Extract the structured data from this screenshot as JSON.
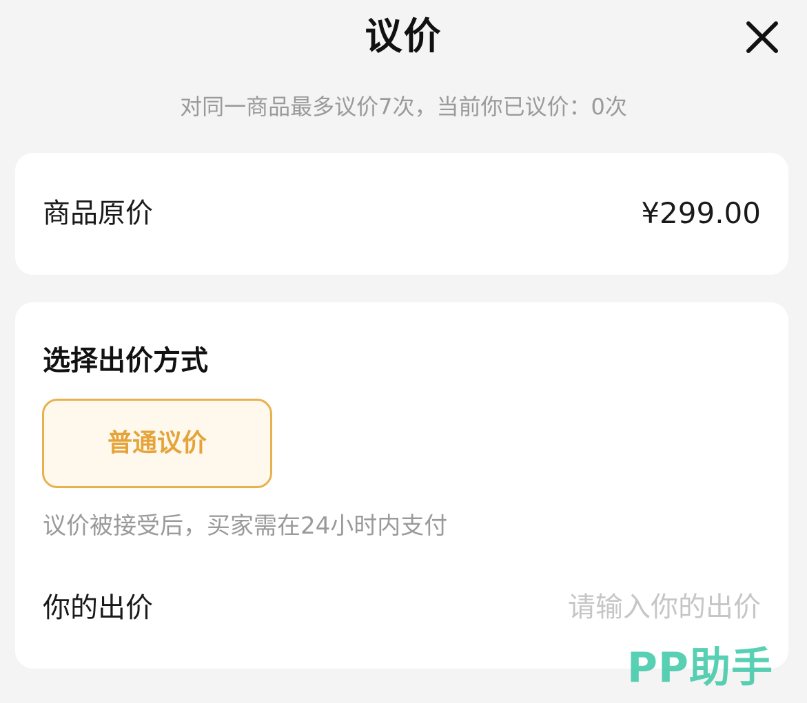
{
  "header": {
    "title": "议价",
    "close_icon": "close-icon"
  },
  "subtitle": "对同一商品最多议价7次，当前你已议价：0次",
  "price_card": {
    "label": "商品原价",
    "value": "¥299.00"
  },
  "offer_card": {
    "section_title": "选择出价方式",
    "method_button": "普通议价",
    "method_description": "议价被接受后，买家需在24小时内支付",
    "bid_label": "你的出价",
    "bid_value": "",
    "bid_placeholder": "请输入你的出价"
  },
  "watermark": "PP助手",
  "colors": {
    "background": "#f4f4f4",
    "card": "#ffffff",
    "accent": "#e4a43a",
    "accent_border": "#e8b14f",
    "accent_bg": "#fff8ec",
    "muted_text": "#9a9a9a",
    "placeholder": "#c6c6c6",
    "watermark": "#3cc8a6"
  }
}
